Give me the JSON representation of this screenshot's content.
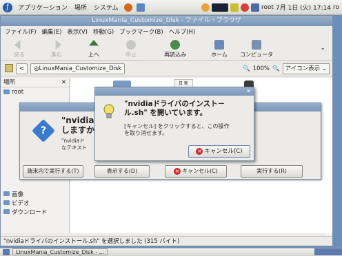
{
  "top_panel": {
    "menus": [
      "アプリケーション",
      "場所",
      "システム"
    ],
    "user": "root",
    "clock": "7月 1日 (火) 17:14",
    "clock_suffix": "ro"
  },
  "file_manager": {
    "title": "LinuxMania_Customize_Disk - ファイル・ブラウザ",
    "menu": [
      "ファイル(F)",
      "編集(E)",
      "表示(V)",
      "移動(G)",
      "ブックマーク(B)",
      "ヘルプ(H)"
    ],
    "toolbar": [
      {
        "label": "戻る",
        "icon": "back-icon",
        "disabled": true
      },
      {
        "label": "進む",
        "icon": "forward-icon",
        "disabled": true
      },
      {
        "label": "上へ",
        "icon": "up-icon",
        "disabled": false
      },
      {
        "label": "中止",
        "icon": "stop-icon",
        "disabled": true
      },
      {
        "label": "再読込み",
        "icon": "reload-icon",
        "disabled": false
      },
      {
        "label": "ホーム",
        "icon": "home-icon",
        "disabled": false
      },
      {
        "label": "コンピュータ",
        "icon": "computer-icon",
        "disabled": false
      }
    ],
    "location": "LinuxMania_Customize_Disk",
    "zoom": "100%",
    "view_mode": "アイコン表示",
    "sidebar_header": "場所",
    "sidebar_items": [
      "root",
      "画像",
      "ビデオ",
      "ダウンロード"
    ],
    "status": "\"nvidiaドライバのインストール.sh\" を選択しました (315 バイト)",
    "file_label_partial": "日 新"
  },
  "exec_dialog": {
    "heading_line1": "\"nvidia",
    "heading_line2": "しますか",
    "body_line1": "\"nvidiaド",
    "body_line2": "なテキスト",
    "buttons": {
      "terminal": "端末内で実行する(T)",
      "show": "表示する(D)",
      "cancel": "キャンセル(C)",
      "run": "実行する(R)"
    }
  },
  "progress_dialog": {
    "heading_line1": "\"nvidiaドライバのインスト－",
    "heading_line2": "ル.sh\" を開いています。",
    "body_line1": "[キャンセル] をクリックすると、この操作",
    "body_line2": "を取り消せます。",
    "cancel_label": "キャンセル(C)"
  },
  "taskbar": {
    "task": "LinuxMania_Customize_Disk - ..."
  },
  "desktop_logo": "iA",
  "colors": {
    "title_blue": "#7a96b8",
    "cancel_red": "#cc2a2a",
    "folder_blue": "#6e94c8"
  }
}
